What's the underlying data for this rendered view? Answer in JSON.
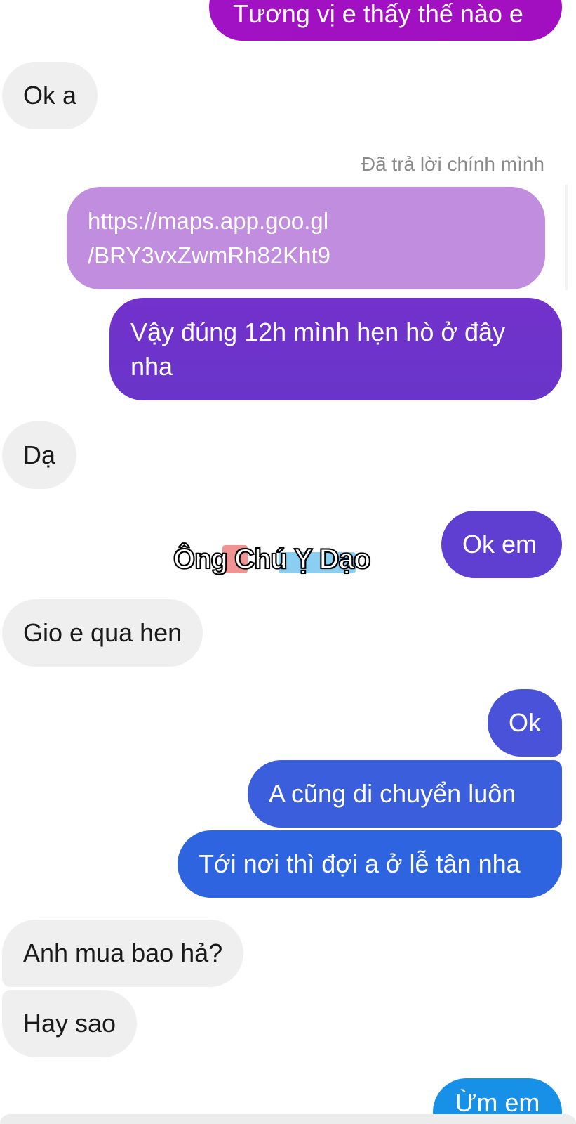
{
  "messages": [
    {
      "id": "b1",
      "side": "sent",
      "text": "Tương vị e thấy thế nào e"
    },
    {
      "id": "b2",
      "side": "received",
      "text": "Ok a"
    },
    {
      "id": "b3",
      "side": "sent",
      "text": "https://maps.app.goo.gl\n/BRY3vxZwmRh82Kht9",
      "reply_label": "Đã trả lời chính mình"
    },
    {
      "id": "b4",
      "side": "sent",
      "text": "Vậy đúng 12h mình hẹn hò ở đây nha"
    },
    {
      "id": "b5",
      "side": "received",
      "text": "Dạ"
    },
    {
      "id": "b6",
      "side": "sent",
      "text": "Ok em"
    },
    {
      "id": "b7",
      "side": "received",
      "text": "Gio e qua hen"
    },
    {
      "id": "b8",
      "side": "sent",
      "text": "Ok"
    },
    {
      "id": "b9",
      "side": "sent",
      "text": "A cũng di chuyển luôn"
    },
    {
      "id": "b10",
      "side": "sent",
      "text": "Tới nơi thì đợi a ở lễ tân nha"
    },
    {
      "id": "b11",
      "side": "received",
      "text": "Anh mua bao hả?"
    },
    {
      "id": "b12",
      "side": "received",
      "text": "Hay sao"
    },
    {
      "id": "b13",
      "side": "sent",
      "text": "Ừm em"
    }
  ],
  "reply_meta": "Đã trả lời chính mình",
  "watermark": "Ông Chú Ỵ Dạo",
  "colors": {
    "received_bg": "#efefef",
    "sent_gradient_top": "#a012c3",
    "sent_gradient_bottom": "#1790e8"
  }
}
